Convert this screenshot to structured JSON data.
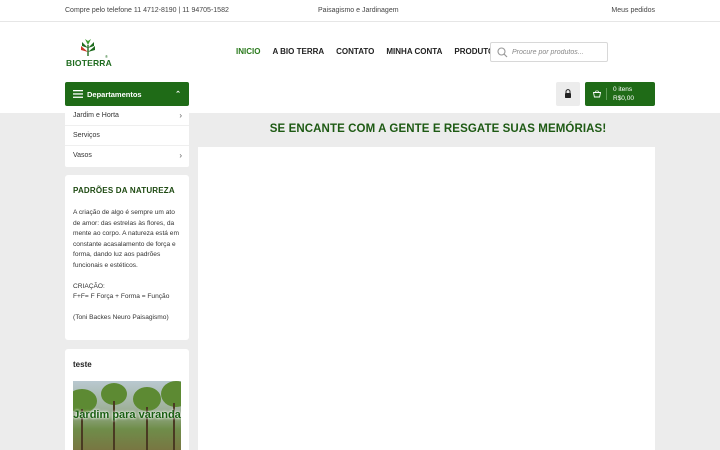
{
  "topbar": {
    "phone": "Compre pelo telefone 11 4712-8190 | 11 94705-1582",
    "tagline": "Paisagismo e Jardinagem",
    "orders_link": "Meus pedidos"
  },
  "brand": {
    "name": "BIOTERRA",
    "reg_mark": "®",
    "color": "#1e6b1e"
  },
  "nav": {
    "items": [
      {
        "label": "INICIO",
        "active": true
      },
      {
        "label": "A BIO TERRA",
        "active": false
      },
      {
        "label": "CONTATO",
        "active": false
      },
      {
        "label": "MINHA CONTA",
        "active": false
      },
      {
        "label": "PRODUTOS",
        "active": false
      }
    ]
  },
  "search": {
    "placeholder": "Procure por produtos...",
    "icon": "search-icon"
  },
  "departments": {
    "button_label": "Departamentos",
    "items": [
      {
        "label": "Jardim e Horta",
        "has_children": true
      },
      {
        "label": "Serviços",
        "has_children": false
      },
      {
        "label": "Vasos",
        "has_children": true
      }
    ]
  },
  "cart": {
    "items_label": "0 itens",
    "total": "R$0,00"
  },
  "colors": {
    "accent": "#1f6b17",
    "active_nav": "#2a7a1c",
    "page_bg": "#ececec"
  },
  "widgets": {
    "nature": {
      "title": "PADRÕES DA NATUREZA",
      "paragraph1": "A criação de algo é sempre um ato de amor: das estrelas às flores, da mente ao corpo. A natureza está em constante acasalamento de força e forma, dando luz aos padrões funcionais e estéticos.",
      "creation_label": "CRIAÇÃO:",
      "formula": "F+F= F Força + Forma = Função",
      "author": "(Toni Backes Neuro Paisagismo)"
    },
    "teste": {
      "title": "teste",
      "banner_text": "Jardim para varanda"
    }
  },
  "main": {
    "headline": "SE ENCANTE COM A GENTE E RESGATE SUAS MEMÓRIAS!"
  }
}
